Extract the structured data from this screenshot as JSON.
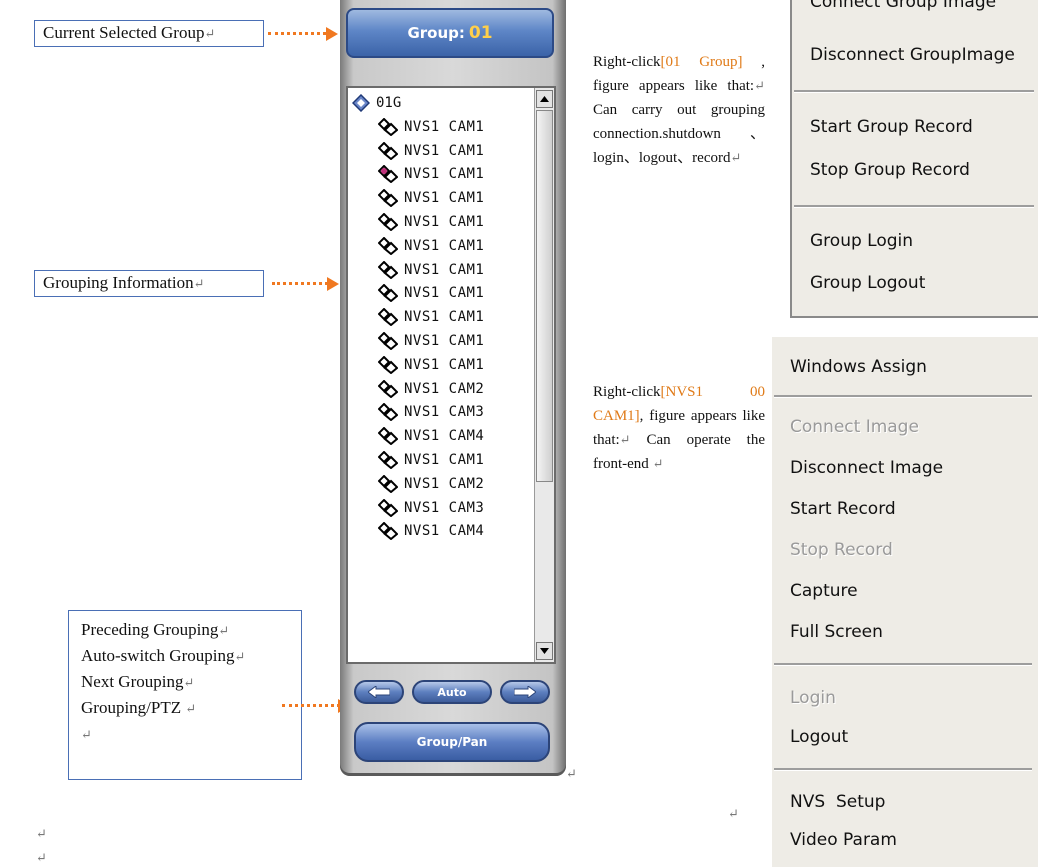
{
  "callouts": {
    "current_group": "Current Selected Group",
    "grouping_info": "Grouping Information",
    "nav_lines": [
      "Preceding Grouping",
      "Auto-switch Grouping",
      "Next Grouping",
      "Grouping/PTZ"
    ]
  },
  "para_mark": "↵",
  "panel": {
    "group_label": "Group:",
    "group_number": "01",
    "tree_root": "01G",
    "tree_items": [
      "NVS1 CAM1",
      "NVS1 CAM1",
      "NVS1 CAM1",
      "NVS1 CAM1",
      "NVS1 CAM1",
      "NVS1 CAM1",
      "NVS1 CAM1",
      "NVS1 CAM1",
      "NVS1 CAM1",
      "NVS1 CAM1",
      "NVS1 CAM1",
      "NVS1 CAM2",
      "NVS1 CAM3",
      "NVS1 CAM4",
      "NVS1 CAM1",
      "NVS1 CAM2",
      "NVS1 CAM3",
      "NVS1 CAM4"
    ],
    "selected_item_index": 2,
    "auto_label": "Auto",
    "group_pan_label": "Group/Pan"
  },
  "descriptions": {
    "group": {
      "prefix": "Right-click",
      "highlight": "[01 Group]",
      "suffix": " , figure appears like that:",
      "body": "Can carry out grouping connection.shutdown、login、logout、record"
    },
    "camera": {
      "prefix": "Right-click",
      "highlight": "[NVS1 00 CAM1]",
      "suffix": ", figure appears like that:",
      "body": "Can operate the front-end"
    }
  },
  "group_menu": {
    "items": [
      {
        "label": "Connect Group Image",
        "enabled": true
      },
      {
        "label": "Disconnect GroupImage",
        "enabled": true
      },
      {
        "label": "Start Group Record",
        "enabled": true
      },
      {
        "label": "Stop Group Record",
        "enabled": true
      },
      {
        "label": "Group Login",
        "enabled": true
      },
      {
        "label": "Group Logout",
        "enabled": true
      }
    ]
  },
  "camera_menu": {
    "items": [
      {
        "label": "Windows Assign",
        "enabled": true
      },
      {
        "label": "Connect Image",
        "enabled": false
      },
      {
        "label": "Disconnect Image",
        "enabled": true
      },
      {
        "label": "Start Record",
        "enabled": true
      },
      {
        "label": "Stop Record",
        "enabled": false
      },
      {
        "label": "Capture",
        "enabled": true
      },
      {
        "label": "Full Screen",
        "enabled": true
      },
      {
        "label": "Login",
        "enabled": false
      },
      {
        "label": "Logout",
        "enabled": true
      },
      {
        "label": "NVS  Setup",
        "enabled": true
      },
      {
        "label": "Video Param",
        "enabled": true
      }
    ]
  },
  "colors": {
    "arrow": "#f07820",
    "highlight_text": "#e07a17",
    "selected_dot": "#c0307a"
  }
}
